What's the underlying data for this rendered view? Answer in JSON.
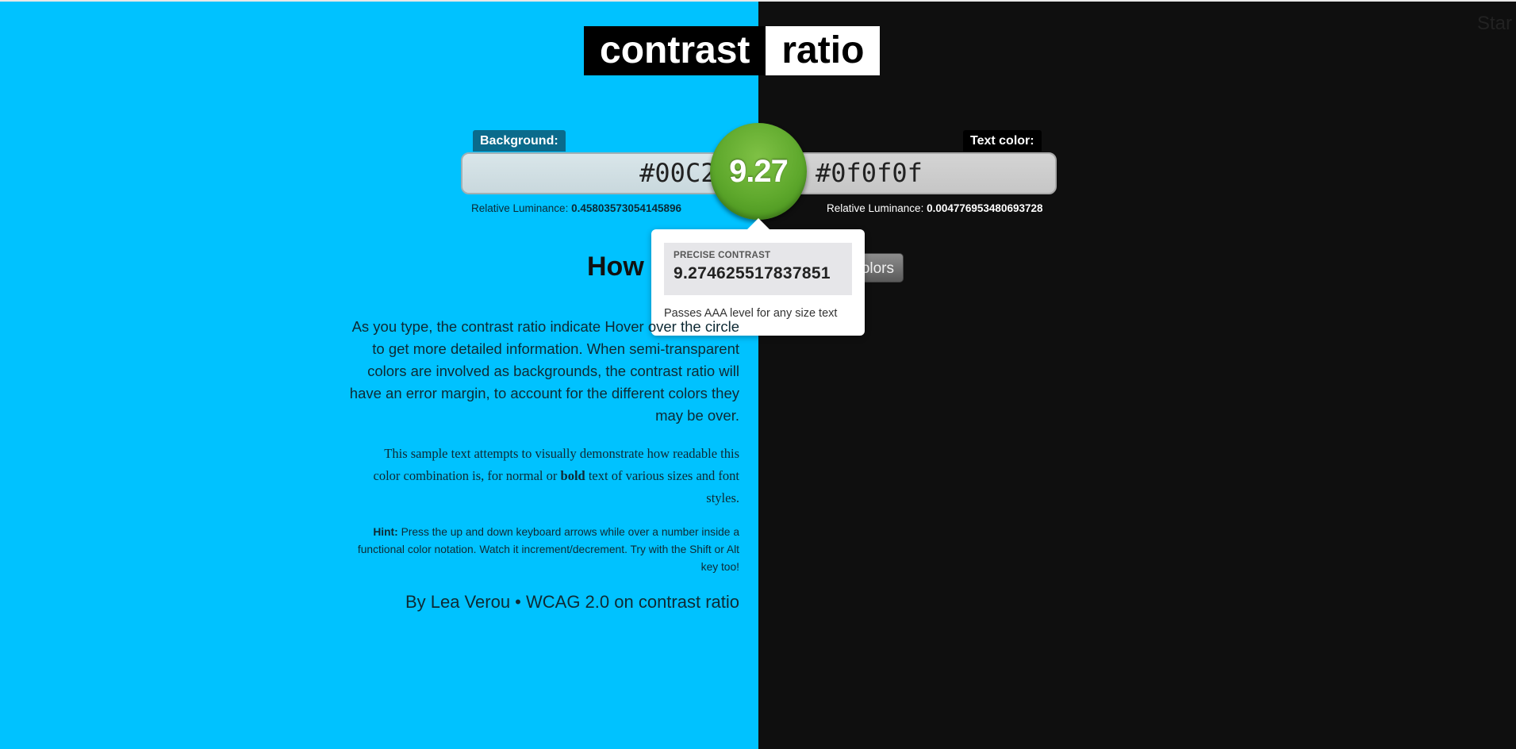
{
  "header": {
    "title_word1": "contrast",
    "title_word2": "ratio",
    "corner_text": "Star"
  },
  "background": {
    "label": "Background:",
    "value": "#00C2FF",
    "luminance_label": "Relative Luminance:",
    "luminance_value": "0.45803573054145896",
    "color": "#00C2FF"
  },
  "foreground": {
    "label": "Text color:",
    "value": "#0f0f0f",
    "luminance_label": "Relative Luminance:",
    "luminance_value": "0.004776953480693728",
    "color": "#0f0f0f"
  },
  "result": {
    "ratio": "9.27",
    "precise_label": "PRECISE CONTRAST",
    "precise_value": "9.274625517837851",
    "passes_text": "Passes AAA level for any size text",
    "status_color": "#5ea82c"
  },
  "swap_button": {
    "label": "olors"
  },
  "content": {
    "heading": "How",
    "paragraph1": "As you type, the contrast ratio indicate Hover over the circle to get more detailed information. When semi-transparent colors are involved as backgrounds, the contrast ratio will have an error margin, to account for the different colors they may be over.",
    "sample_prefix": "This sample text attempts to visually demonstrate how readable this color combination is, for normal or ",
    "sample_bold": "bold",
    "sample_suffix": " text of various sizes and font styles.",
    "hint_label": "Hint:",
    "hint_text": " Press the up and down keyboard arrows while over a number inside a functional color notation. Watch it increment/decrement. Try with the Shift or Alt key too!",
    "credit_author": "By Lea Verou",
    "credit_separator": " • ",
    "credit_link": "WCAG 2.0 on contrast ratio"
  }
}
